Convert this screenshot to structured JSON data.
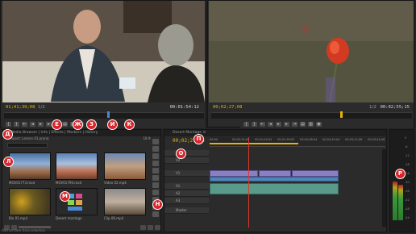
{
  "source_monitor": {
    "timecode_current": "01;41;39;08",
    "timecode_duration": "00:01:54:12",
    "zoom": "1/2"
  },
  "program_monitor": {
    "timecode_current": "00;02;27;08",
    "timecode_duration": "00:02;55;15",
    "zoom": "1/2"
  },
  "project_panel": {
    "tab_label": "Media Browser | Info | Effects | Markers | History",
    "title": "Project: Lesson 01.prproj",
    "item_count": "18 Items",
    "clips": [
      {
        "caption": "MOV01773.mod"
      },
      {
        "caption": "MOV01790.mod"
      },
      {
        "caption": "Video 02.mp4"
      },
      {
        "caption": "Bin 01.mp4"
      },
      {
        "caption": "Desert montage"
      },
      {
        "caption": "Clip 06.mp4"
      }
    ]
  },
  "timeline_panel": {
    "title": "Desert Montage ≡",
    "timecode": "00;02;27;08",
    "ruler": [
      "00;00",
      "00;00;32;00",
      "00;01;04;02",
      "00;01;36;02",
      "00;02;08;04",
      "00;02;40;04",
      "00;03;12;06",
      "00;03;44;06"
    ],
    "tracks": [
      "V3",
      "V2",
      "V1",
      "A1",
      "A2",
      "A3",
      "Master"
    ]
  },
  "meters": {
    "scale": [
      "0",
      "-6",
      "-12",
      "-18",
      "-24",
      "-30",
      "-36",
      "-42",
      "-48",
      "-54"
    ]
  },
  "status_text": "Add an item from selection",
  "callouts": [
    "Д",
    "Е",
    "Ж",
    "З",
    "И",
    "К",
    "Л",
    "М",
    "Н",
    "О",
    "П",
    "Р"
  ],
  "colors": {
    "accent": "#e9b400",
    "badge": "#d8262c",
    "playhead": "#d83a2a"
  }
}
